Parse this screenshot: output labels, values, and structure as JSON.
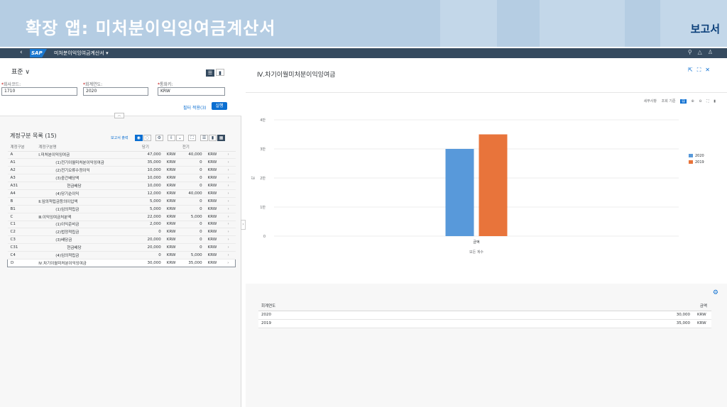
{
  "banner": {
    "title": "확장 앱: 미처분이익잉여금계산서",
    "tag": "보고서"
  },
  "shell": {
    "back_icon": "chevron-left-icon",
    "logo": "SAP",
    "app_title": "미처분이익잉여금계산서 ▾",
    "icons": [
      "search-icon",
      "bell-icon",
      "user-icon"
    ]
  },
  "filterbar": {
    "variant": "표준 ∨",
    "fields": [
      {
        "label": "회사코드:",
        "value": "1710"
      },
      {
        "label": "회계연도:",
        "value": "2020"
      },
      {
        "label": "통화키:",
        "value": "KRW"
      }
    ],
    "filter_link": "필터 적용(3)",
    "go_button": "실행"
  },
  "table": {
    "title": "계정구분 목록 (15)",
    "report_label": "보고서 출력",
    "columns": [
      "계정구분",
      "계정구분명",
      "당기",
      "",
      "전기",
      ""
    ],
    "rows": [
      {
        "code": "A",
        "name": "Ⅰ.미처분이익잉여금",
        "cur": "47,000",
        "cur_unit": "KRW",
        "prev": "40,000",
        "prev_unit": "KRW",
        "indent": 0
      },
      {
        "code": "A1",
        "name": "(1)전기이월미처분이익잉여금",
        "cur": "35,000",
        "cur_unit": "KRW",
        "prev": "0",
        "prev_unit": "KRW",
        "indent": 1
      },
      {
        "code": "A2",
        "name": "(2)전기오류수정이익",
        "cur": "10,000",
        "cur_unit": "KRW",
        "prev": "0",
        "prev_unit": "KRW",
        "indent": 1
      },
      {
        "code": "A3",
        "name": "(3)중간배당액",
        "cur": "10,000",
        "cur_unit": "KRW",
        "prev": "0",
        "prev_unit": "KRW",
        "indent": 1
      },
      {
        "code": "A31",
        "name": "현금배당",
        "cur": "10,000",
        "cur_unit": "KRW",
        "prev": "0",
        "prev_unit": "KRW",
        "indent": 2
      },
      {
        "code": "A4",
        "name": "(4)당기순이익",
        "cur": "12,000",
        "cur_unit": "KRW",
        "prev": "40,000",
        "prev_unit": "KRW",
        "indent": 1
      },
      {
        "code": "B",
        "name": "Ⅱ.임의적립금등의이입액",
        "cur": "5,000",
        "cur_unit": "KRW",
        "prev": "0",
        "prev_unit": "KRW",
        "indent": 0
      },
      {
        "code": "B1",
        "name": "(1)임의적립금",
        "cur": "5,000",
        "cur_unit": "KRW",
        "prev": "0",
        "prev_unit": "KRW",
        "indent": 1
      },
      {
        "code": "C",
        "name": "Ⅲ.이익잉여금처분액",
        "cur": "22,000",
        "cur_unit": "KRW",
        "prev": "5,000",
        "prev_unit": "KRW",
        "indent": 0
      },
      {
        "code": "C1",
        "name": "(1)이익준비금",
        "cur": "2,000",
        "cur_unit": "KRW",
        "prev": "0",
        "prev_unit": "KRW",
        "indent": 1
      },
      {
        "code": "C2",
        "name": "(2)법정적립금",
        "cur": "0",
        "cur_unit": "KRW",
        "prev": "0",
        "prev_unit": "KRW",
        "indent": 1
      },
      {
        "code": "C3",
        "name": "(3)배당금",
        "cur": "20,000",
        "cur_unit": "KRW",
        "prev": "0",
        "prev_unit": "KRW",
        "indent": 1
      },
      {
        "code": "C31",
        "name": "현금배당",
        "cur": "20,000",
        "cur_unit": "KRW",
        "prev": "0",
        "prev_unit": "KRW",
        "indent": 2
      },
      {
        "code": "C4",
        "name": "(4)임의적립금",
        "cur": "0",
        "cur_unit": "KRW",
        "prev": "5,000",
        "prev_unit": "KRW",
        "indent": 1
      },
      {
        "code": "D",
        "name": "Ⅳ.차기이월미처분이익잉여금",
        "cur": "30,000",
        "cur_unit": "KRW",
        "prev": "35,000",
        "prev_unit": "KRW",
        "indent": 0,
        "selected": true
      }
    ]
  },
  "detail": {
    "title": "Ⅳ.차기이월미처분이익잉여금",
    "chart_tools": {
      "detail": "세부사항",
      "view_by": "조회 기준"
    },
    "grid": {
      "columns": [
        "회계연도",
        "금액"
      ],
      "rows": [
        {
          "year": "2020",
          "amount": "30,000",
          "unit": "KRW"
        },
        {
          "year": "2019",
          "amount": "35,000",
          "unit": "KRW"
        }
      ]
    }
  },
  "chart_data": {
    "type": "bar",
    "categories": [
      "금액"
    ],
    "series": [
      {
        "name": "2020",
        "values": [
          30000
        ],
        "color": "#5899da"
      },
      {
        "name": "2019",
        "values": [
          35000
        ],
        "color": "#e8743b"
      }
    ],
    "y_ticks": [
      "0",
      "1만",
      "2만",
      "3만",
      "4만"
    ],
    "ylim": [
      0,
      40000
    ],
    "ylabel": "값",
    "xlabel": "모든 계수",
    "legend": "top-right"
  }
}
